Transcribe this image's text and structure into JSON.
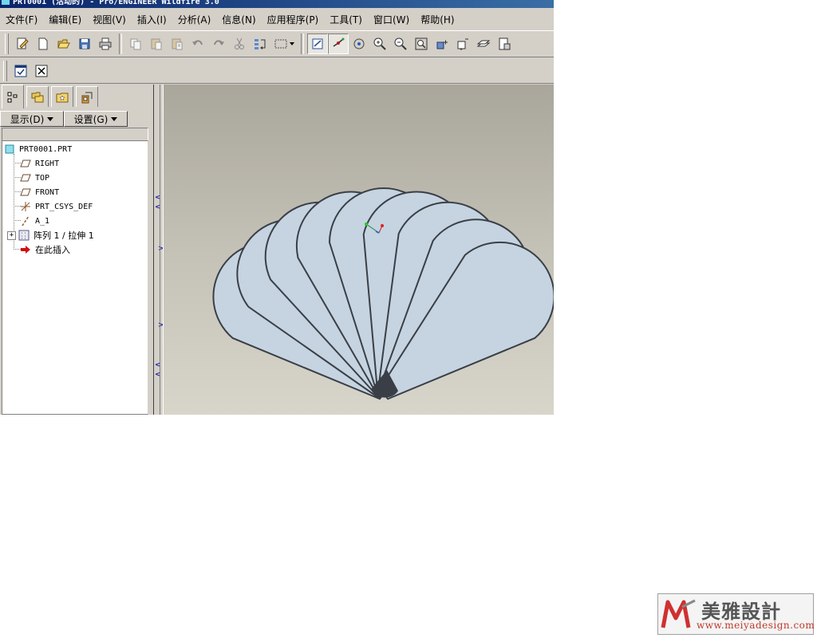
{
  "window": {
    "title": "PRT0001 (活动的) - Pro/ENGINEER Wildfire 3.0"
  },
  "menubar": {
    "items": [
      {
        "label": "文件(F)"
      },
      {
        "label": "编辑(E)"
      },
      {
        "label": "视图(V)"
      },
      {
        "label": "插入(I)"
      },
      {
        "label": "分析(A)"
      },
      {
        "label": "信息(N)"
      },
      {
        "label": "应用程序(P)"
      },
      {
        "label": "工具(T)"
      },
      {
        "label": "窗口(W)"
      },
      {
        "label": "帮助(H)"
      }
    ]
  },
  "toolbar": {
    "icons": [
      "new-part-icon",
      "new-file-icon",
      "open-folder-icon",
      "save-icon",
      "print-icon",
      "copy-icon",
      "paste-icon",
      "paste-special-icon",
      "undo-icon",
      "redo-icon",
      "cut-icon",
      "regenerate-icon",
      "selection-box-icon",
      "datum-plane-display-icon",
      "datum-axis-display-icon",
      "spin-center-icon",
      "zoom-in-icon",
      "zoom-out-icon",
      "refit-icon",
      "orient-icon",
      "saved-views-icon",
      "layers-icon",
      "model-display-icon"
    ]
  },
  "panel": {
    "show_button": "显示(D)",
    "settings_button": "设置(G)",
    "tree": [
      {
        "label": "PRT0001.PRT",
        "icon": "part-icon"
      },
      {
        "label": "RIGHT",
        "icon": "datum-plane-icon"
      },
      {
        "label": "TOP",
        "icon": "datum-plane-icon"
      },
      {
        "label": "FRONT",
        "icon": "datum-plane-icon"
      },
      {
        "label": "PRT_CSYS_DEF",
        "icon": "coordinate-system-icon"
      },
      {
        "label": "A_1",
        "icon": "datum-axis-icon"
      },
      {
        "label": "阵列 1 / 拉伸 1",
        "icon": "pattern-icon"
      },
      {
        "label": "在此插入",
        "icon": "insert-here-arrow-icon"
      }
    ]
  },
  "viewport": {
    "model_color": "#c5d4e0",
    "edge_color": "#3a3f47",
    "background_top": "#a9a69c",
    "background_bottom": "#d8d5cb"
  },
  "watermark": {
    "title": "美雅設計",
    "url": "www.meiyadesign.com"
  }
}
